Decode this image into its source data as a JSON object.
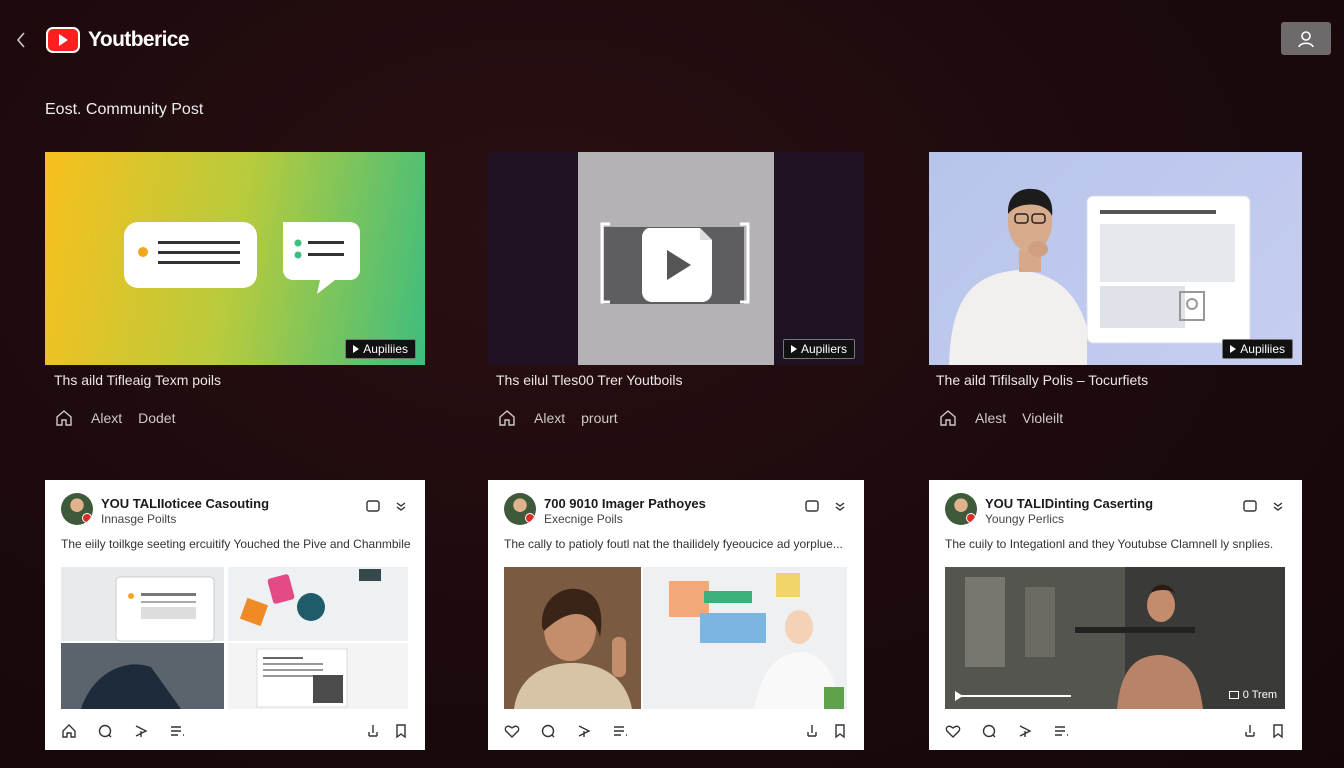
{
  "header": {
    "app_name": "Youtberice",
    "section_title": "Eost. Community Post"
  },
  "cards": [
    {
      "chip_label": "Aupiliies",
      "title": "Ths aild Tifleaig Texm poils",
      "meta_1": "Alext",
      "meta_2": "Dodet"
    },
    {
      "chip_label": "Aupiliers",
      "title": "Ths eilul Tles00 Trer Youtboils",
      "meta_1": "Alext",
      "meta_2": "prourt"
    },
    {
      "chip_label": "Aupiliies",
      "title": "The aild Tifilsally Polis – Tocurfiets",
      "meta_1": "Alest",
      "meta_2": "Violeilt"
    }
  ],
  "posts": [
    {
      "name": "YOU TALIIoticee Casouting",
      "sub": "Innasge Poilts",
      "text": "The eiily toilkge seeting ercuitify Youched the Pive and Chanmbiles"
    },
    {
      "name": "700 9010 Imager Pathoyes",
      "sub": "Execnige Poils",
      "text": "The cally to patioly foutl nat the thailidely fyeoucice ad yorplue..."
    },
    {
      "name": "YOU TALIDinting Caserting",
      "sub": "Youngy Perlics",
      "text": "The cuily to Integationl and they Youtubse Clamnell ly snplies.",
      "video_label": "0 Trem"
    }
  ],
  "colors": {
    "background": "#1c0a0c",
    "brand_red": "#ff1f1f",
    "chip_bg": "#111111"
  }
}
